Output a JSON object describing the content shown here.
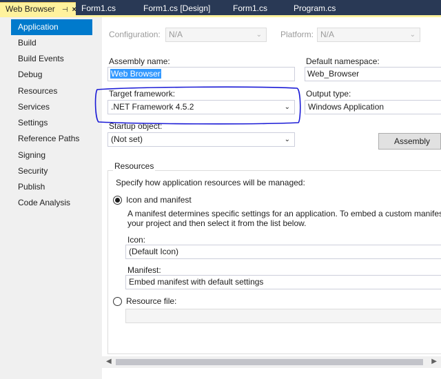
{
  "tabs": [
    {
      "label": "Web Browser",
      "active": true
    },
    {
      "label": "Form1.cs",
      "active": false
    },
    {
      "label": "Form1.cs [Design]",
      "active": false
    },
    {
      "label": "Form1.cs",
      "active": false
    },
    {
      "label": "Program.cs",
      "active": false
    }
  ],
  "tab_pin_glyph": "⊣",
  "tab_close_glyph": "×",
  "nav": {
    "items": [
      {
        "label": "Application"
      },
      {
        "label": "Build"
      },
      {
        "label": "Build Events"
      },
      {
        "label": "Debug"
      },
      {
        "label": "Resources"
      },
      {
        "label": "Services"
      },
      {
        "label": "Settings"
      },
      {
        "label": "Reference Paths"
      },
      {
        "label": "Signing"
      },
      {
        "label": "Security"
      },
      {
        "label": "Publish"
      },
      {
        "label": "Code Analysis"
      }
    ],
    "selected_index": 0
  },
  "config": {
    "configuration_label": "Configuration:",
    "configuration_value": "N/A",
    "platform_label": "Platform:",
    "platform_value": "N/A"
  },
  "assembly": {
    "assembly_name_label": "Assembly name:",
    "assembly_name_value": "Web Browser",
    "default_namespace_label": "Default namespace:",
    "default_namespace_value": "Web_Browser",
    "target_framework_label": "Target framework:",
    "target_framework_value": ".NET Framework 4.5.2",
    "output_type_label": "Output type:",
    "output_type_value": "Windows Application",
    "startup_object_label": "Startup object:",
    "startup_object_value": "(Not set)",
    "assembly_info_button": "Assembly"
  },
  "resources": {
    "group_title": "Resources",
    "description": "Specify how application resources will be managed:",
    "icon_manifest_label": "Icon and manifest",
    "icon_manifest_selected": true,
    "icon_manifest_desc_line1": "A manifest determines specific settings for an application. To embed a custom manifest, f",
    "icon_manifest_desc_line2": "your project and then select it from the list below.",
    "icon_label": "Icon:",
    "icon_value": "(Default Icon)",
    "manifest_label": "Manifest:",
    "manifest_value": "Embed manifest with default settings",
    "resource_file_label": "Resource file:",
    "resource_file_value": ""
  },
  "icons": {
    "chevron": "chevron-down-icon",
    "pin": "pin-icon",
    "close": "close-icon"
  },
  "colors": {
    "accent": "#007acc",
    "tab_active": "#fff29d",
    "tab_strip": "#293955",
    "annotation": "#1a1ad6"
  }
}
